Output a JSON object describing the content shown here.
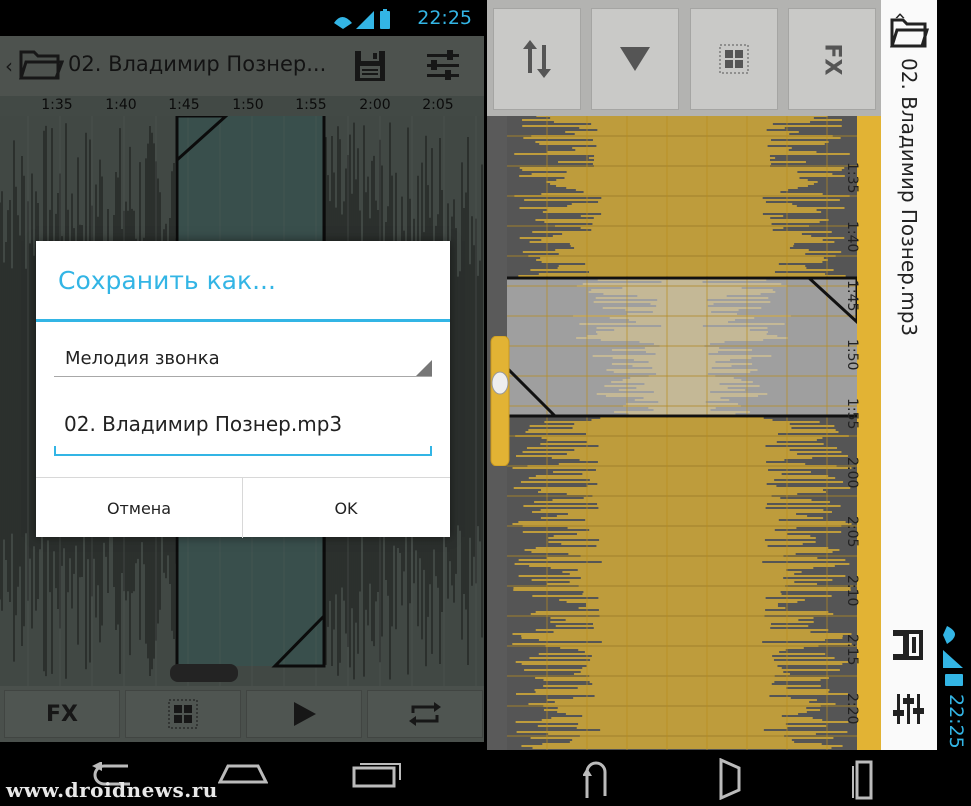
{
  "left_screen": {
    "status": {
      "time": "22:25"
    },
    "actionbar": {
      "title": "02. Владимир Познер...",
      "icons": [
        "back-chevron-icon",
        "folder-icon",
        "save-icon",
        "sliders-icon"
      ]
    },
    "timeline": [
      "1:35",
      "1:40",
      "1:45",
      "1:50",
      "1:55",
      "2:00",
      "2:05"
    ],
    "dialog": {
      "title": "Сохранить как...",
      "type_value": "Мелодия звонка",
      "filename_value": "02. Владимир Познер.mp3",
      "cancel_label": "Отмена",
      "ok_label": "OK"
    },
    "bottom_tools": {
      "fx_label": "FX",
      "icons": [
        "grid-icon",
        "play-icon",
        "repeat-icon"
      ]
    },
    "navbar": {
      "icons": [
        "back-icon",
        "home-icon",
        "recents-icon"
      ]
    },
    "watermark": "www.droidnews.ru"
  },
  "right_screen": {
    "toolbar": {
      "fx_label": "FX",
      "icons": [
        "swap-icon",
        "down-triangle-icon",
        "grid-icon"
      ]
    },
    "title": "02. Владимир Познер.mp3",
    "timeline": [
      "1:35",
      "1:40",
      "1:45",
      "1:50",
      "1:55",
      "2:00",
      "2:05",
      "2:10",
      "2:15",
      "2:20"
    ],
    "side_icons": [
      "save-icon",
      "sliders-icon"
    ],
    "status": {
      "time": "22:25"
    },
    "navbar": {
      "icons": [
        "back-icon",
        "home-icon",
        "recents-icon"
      ]
    }
  },
  "colors": {
    "accent": "#33b5e5",
    "wave_left_bg": "#5e6762",
    "wave_left_fg": "#2a2f2c",
    "selection_left": "#4f7670",
    "wave_right_bg": "#e2b334",
    "wave_right_fg": "#555555",
    "selection_right": "#c8c8c8"
  }
}
